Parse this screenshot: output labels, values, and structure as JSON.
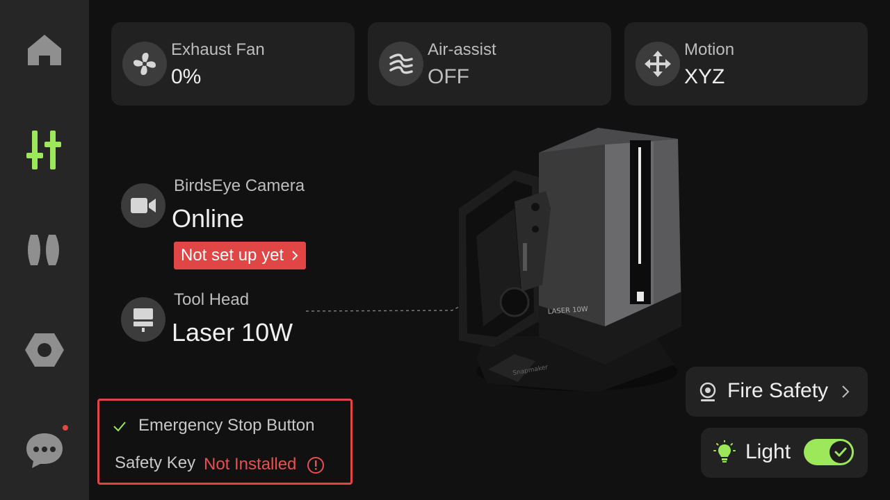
{
  "sidebar": {
    "items": [
      {
        "icon": "home-icon",
        "active": false
      },
      {
        "icon": "sliders-icon",
        "active": true
      },
      {
        "icon": "material-icon",
        "active": false
      },
      {
        "icon": "nut-settings-icon",
        "active": false
      },
      {
        "icon": "chat-icon",
        "active": false,
        "notification": true
      }
    ]
  },
  "status_cards": [
    {
      "icon": "fan-icon",
      "label": "Exhaust Fan",
      "value": "0%"
    },
    {
      "icon": "air-assist-icon",
      "label": "Air-assist",
      "value": "OFF"
    },
    {
      "icon": "move-arrows-icon",
      "label": "Motion",
      "value": "XYZ"
    }
  ],
  "camera": {
    "icon": "video-camera-icon",
    "label": "BirdsEye Camera",
    "value": "Online",
    "setup_label": "Not set up yet"
  },
  "tool_head": {
    "icon": "toolhead-icon",
    "label": "Tool Head",
    "value": "Laser 10W"
  },
  "device_image": {
    "logo_text": "LASER 10W",
    "engraving": "Snapmaker"
  },
  "safety": {
    "estop_label": "Emergency Stop Button",
    "key_label": "Safety Key",
    "key_status": "Not Installed"
  },
  "fire_safety": {
    "label": "Fire Safety"
  },
  "light": {
    "label": "Light",
    "on": true
  },
  "colors": {
    "accent_green": "#9de85a",
    "alert_red": "#e04646",
    "background": "#111111",
    "sidebar": "#262626",
    "card": "#212121"
  }
}
